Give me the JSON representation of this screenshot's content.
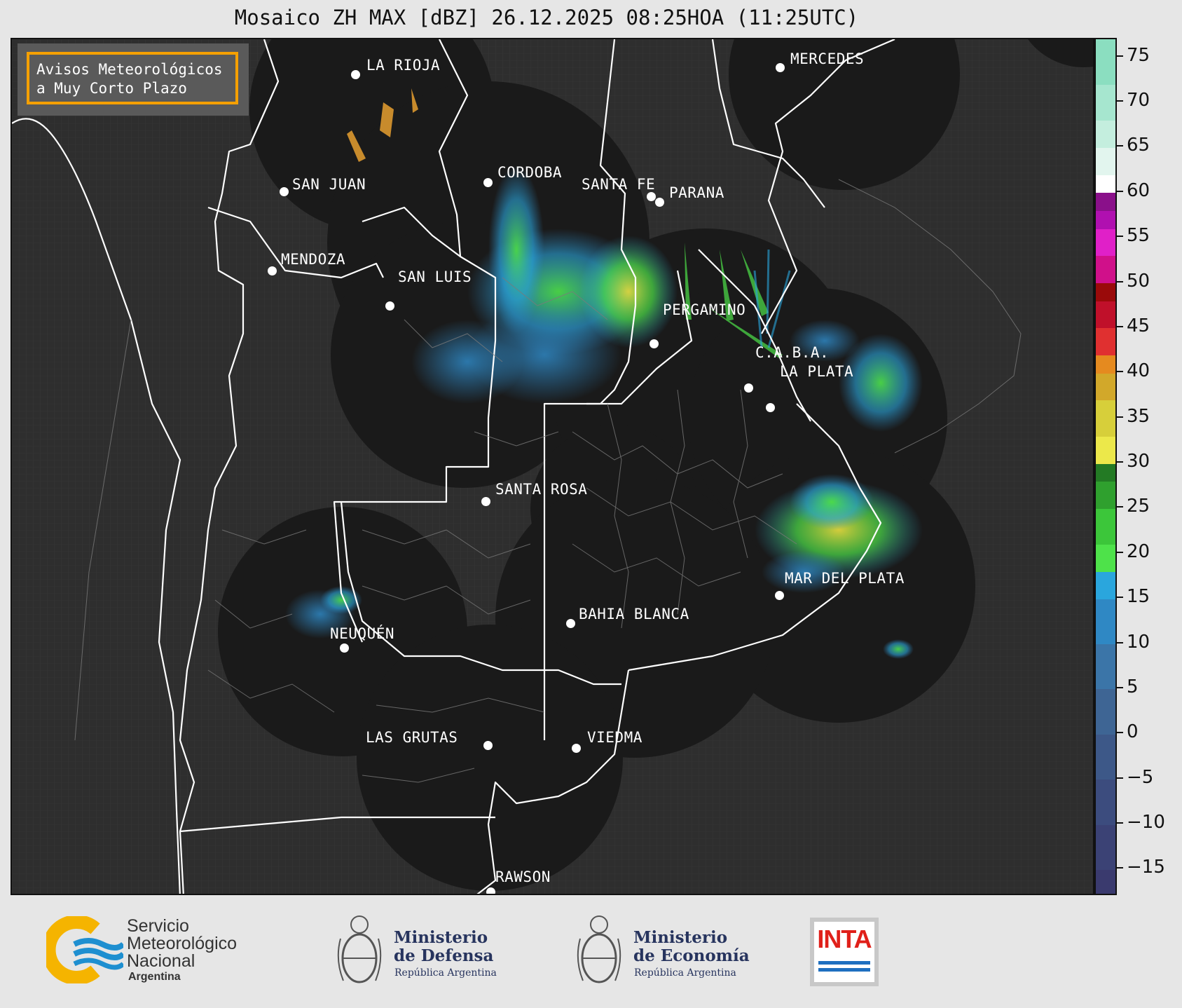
{
  "title": "Mosaico ZH MAX [dBZ] 26.12.2025 08:25HOA (11:25UTC)",
  "avisos": {
    "line1": "Avisos Meteorológicos",
    "line2": "a Muy Corto Plazo"
  },
  "cities": [
    {
      "name": "LA RIOJA",
      "label": "LA RIOJA"
    },
    {
      "name": "MERCEDES",
      "label": "MERCEDES"
    },
    {
      "name": "SAN JUAN",
      "label": "SAN JUAN"
    },
    {
      "name": "CORDOBA",
      "label": "CORDOBA"
    },
    {
      "name": "SANTA FE",
      "label": "SANTA FE"
    },
    {
      "name": "PARANA",
      "label": "PARANA"
    },
    {
      "name": "MENDOZA",
      "label": "MENDOZA"
    },
    {
      "name": "SAN LUIS",
      "label": "SAN LUIS"
    },
    {
      "name": "PERGAMINO",
      "label": "PERGAMINO"
    },
    {
      "name": "C.A.B.A.",
      "label": "C.A.B.A."
    },
    {
      "name": "LA PLATA",
      "label": "LA PLATA"
    },
    {
      "name": "SANTA ROSA",
      "label": "SANTA ROSA"
    },
    {
      "name": "MAR DEL PLATA",
      "label": "MAR DEL PLATA"
    },
    {
      "name": "BAHIA BLANCA",
      "label": "BAHIA BLANCA"
    },
    {
      "name": "NEUQUEN",
      "label": "NEUQUÉN"
    },
    {
      "name": "LAS GRUTAS",
      "label": "LAS GRUTAS"
    },
    {
      "name": "VIEDMA",
      "label": "VIEDMA"
    },
    {
      "name": "RAWSON",
      "label": "RAWSON"
    }
  ],
  "colorbar": {
    "unit": "dBZ",
    "min": -18,
    "max": 77,
    "tick_labels": [
      "75",
      "70",
      "65",
      "60",
      "55",
      "50",
      "45",
      "40",
      "35",
      "30",
      "25",
      "20",
      "15",
      "10",
      "5",
      "0",
      "−5",
      "−10",
      "−15"
    ],
    "tick_values": [
      75,
      70,
      65,
      60,
      55,
      50,
      45,
      40,
      35,
      30,
      25,
      20,
      15,
      10,
      5,
      0,
      -5,
      -10,
      -15
    ],
    "segments": [
      {
        "from": -18,
        "to": -15,
        "color": "#3a3a6e"
      },
      {
        "from": -15,
        "to": -10,
        "color": "#3b4275"
      },
      {
        "from": -10,
        "to": -5,
        "color": "#3c4c7e"
      },
      {
        "from": -5,
        "to": 0,
        "color": "#3d5888"
      },
      {
        "from": 0,
        "to": 5,
        "color": "#3e6594"
      },
      {
        "from": 5,
        "to": 10,
        "color": "#3b75a8"
      },
      {
        "from": 10,
        "to": 15,
        "color": "#2f88c4"
      },
      {
        "from": 15,
        "to": 18,
        "color": "#2aa6dd"
      },
      {
        "from": 18,
        "to": 21,
        "color": "#4ee24a"
      },
      {
        "from": 21,
        "to": 25,
        "color": "#3cc63a"
      },
      {
        "from": 25,
        "to": 28,
        "color": "#2fa02e"
      },
      {
        "from": 28,
        "to": 30,
        "color": "#237a24"
      },
      {
        "from": 30,
        "to": 33,
        "color": "#ece84a"
      },
      {
        "from": 33,
        "to": 37,
        "color": "#d7cf3a"
      },
      {
        "from": 37,
        "to": 40,
        "color": "#d2a82a"
      },
      {
        "from": 40,
        "to": 42,
        "color": "#e58a1f"
      },
      {
        "from": 42,
        "to": 45,
        "color": "#e03030"
      },
      {
        "from": 45,
        "to": 48,
        "color": "#c0102a"
      },
      {
        "from": 48,
        "to": 50,
        "color": "#9a0a0a"
      },
      {
        "from": 50,
        "to": 53,
        "color": "#d0108a"
      },
      {
        "from": 53,
        "to": 56,
        "color": "#e020c8"
      },
      {
        "from": 56,
        "to": 58,
        "color": "#b010b0"
      },
      {
        "from": 58,
        "to": 60,
        "color": "#8a108a"
      },
      {
        "from": 60,
        "to": 62,
        "color": "#ffffff"
      },
      {
        "from": 62,
        "to": 65,
        "color": "#e2f5ee"
      },
      {
        "from": 65,
        "to": 68,
        "color": "#c4eede"
      },
      {
        "from": 68,
        "to": 72,
        "color": "#a6e6cf"
      },
      {
        "from": 72,
        "to": 77,
        "color": "#8bdec0"
      }
    ]
  },
  "footer": {
    "smn": {
      "line1": "Servicio",
      "line2": "Meteorológico",
      "line3": "Nacional",
      "line4": "Argentina"
    },
    "defensa": {
      "line1": "Ministerio",
      "line2": "de Defensa",
      "line3": "República Argentina"
    },
    "economia": {
      "line1": "Ministerio",
      "line2": "de Economía",
      "line3": "República Argentina"
    },
    "inta": {
      "label": "INTA"
    }
  },
  "colors": {
    "map_bg": "#2e2e2e",
    "radar_disc": "#1a1a1a",
    "border": "#ffffff",
    "accent": "#f5a000",
    "smn_blue": "#1e8fd0",
    "smn_yellow": "#f5b400",
    "inta_red": "#e0201a"
  }
}
